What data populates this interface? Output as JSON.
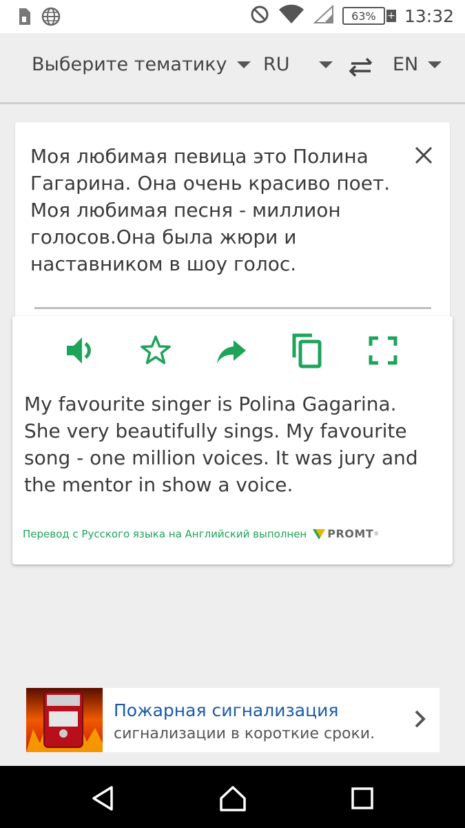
{
  "status_bar": {
    "time": "13:32",
    "battery_percent": "63%",
    "icons": [
      "sim-icon",
      "globe-icon",
      "dnd-icon",
      "wifi-icon",
      "signal-icon",
      "battery-icon"
    ]
  },
  "toolbar": {
    "topic_label": "Выберите тематику",
    "source_lang": "RU",
    "target_lang": "EN"
  },
  "source": {
    "text": "Моя любимая певица это Полина Гагарина. Она очень красиво поет. Моя любимая песня - миллион голосов.Она была жюри и наставником в шоу голос."
  },
  "result": {
    "text": "My favourite singer is Polina Gagarina. She very beautifully sings. My favourite song - one million voices. It was jury and the mentor in show a voice.",
    "credit": "Перевод с Русского языка на Английский выполнен",
    "brand": "PROMT",
    "brand_mark": "®"
  },
  "ad": {
    "title": "Пожарная сигнализация",
    "subtitle": "сигнализации в короткие сроки."
  },
  "colors": {
    "accent": "#1ea35a",
    "link": "#1a5aa8"
  }
}
